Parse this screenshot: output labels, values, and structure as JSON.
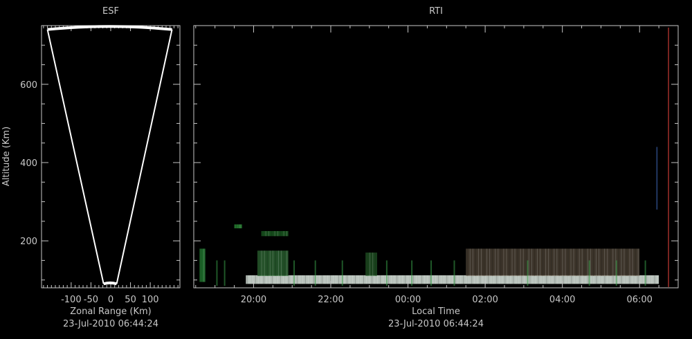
{
  "chart_data": [
    {
      "type": "esf_fan",
      "title": "ESF",
      "xlabel": "Zonal Range (Km)",
      "ylabel": "Altitude (Km)",
      "timestamp": "23-Jul-2010 06:44:24",
      "xlim": [
        -175,
        175
      ],
      "ylim": [
        80,
        750
      ],
      "x_ticks": [
        -100,
        -50,
        0,
        50,
        100
      ],
      "x_tick_labels": [
        "-100",
        "-50",
        "0",
        "50",
        "100"
      ],
      "y_ticks": [
        200,
        400,
        600
      ],
      "y_tick_labels": [
        "200",
        "400",
        "600"
      ],
      "beam": {
        "inner_altitude": 90,
        "outer_altitude": 745,
        "outer_left_range": -160,
        "outer_right_range": 155,
        "inner_left_range": -18,
        "inner_right_range": 15
      }
    },
    {
      "type": "heatmap",
      "title": "RTI",
      "xlabel": "Local Time",
      "timestamp": "23-Jul-2010 06:44:24",
      "xlim": [
        18.45,
        31.0
      ],
      "ylim": [
        80,
        750
      ],
      "x_ticks": [
        20,
        22,
        24,
        26,
        28,
        30
      ],
      "x_tick_labels": [
        "20:00",
        "22:00",
        "00:00",
        "02:00",
        "04:00",
        "06:00"
      ],
      "y_ticks": [
        200,
        400,
        600
      ],
      "echo_regions": [
        {
          "t0": 19.8,
          "t1": 30.5,
          "alt0": 90,
          "alt1": 112,
          "color": "#e6f2ea",
          "opacity": 0.8
        },
        {
          "t0": 20.1,
          "t1": 20.9,
          "alt0": 110,
          "alt1": 175,
          "color": "#2f6b35",
          "opacity": 0.75
        },
        {
          "t0": 25.5,
          "t1": 30.0,
          "alt0": 110,
          "alt1": 180,
          "color": "#6e5f4c",
          "opacity": 0.55
        },
        {
          "t0": 22.9,
          "t1": 23.2,
          "alt0": 110,
          "alt1": 170,
          "color": "#2c6e30",
          "opacity": 0.6
        },
        {
          "t0": 20.2,
          "t1": 20.9,
          "alt0": 212,
          "alt1": 225,
          "color": "#1f6a28",
          "opacity": 0.7
        },
        {
          "t0": 19.5,
          "t1": 19.7,
          "alt0": 232,
          "alt1": 242,
          "color": "#2b8a36",
          "opacity": 0.8
        },
        {
          "t0": 18.6,
          "t1": 18.75,
          "alt0": 95,
          "alt1": 180,
          "color": "#2a8f3a",
          "opacity": 0.7
        }
      ],
      "vertical_line": {
        "t": 30.75,
        "color": "#a0302a"
      }
    }
  ]
}
